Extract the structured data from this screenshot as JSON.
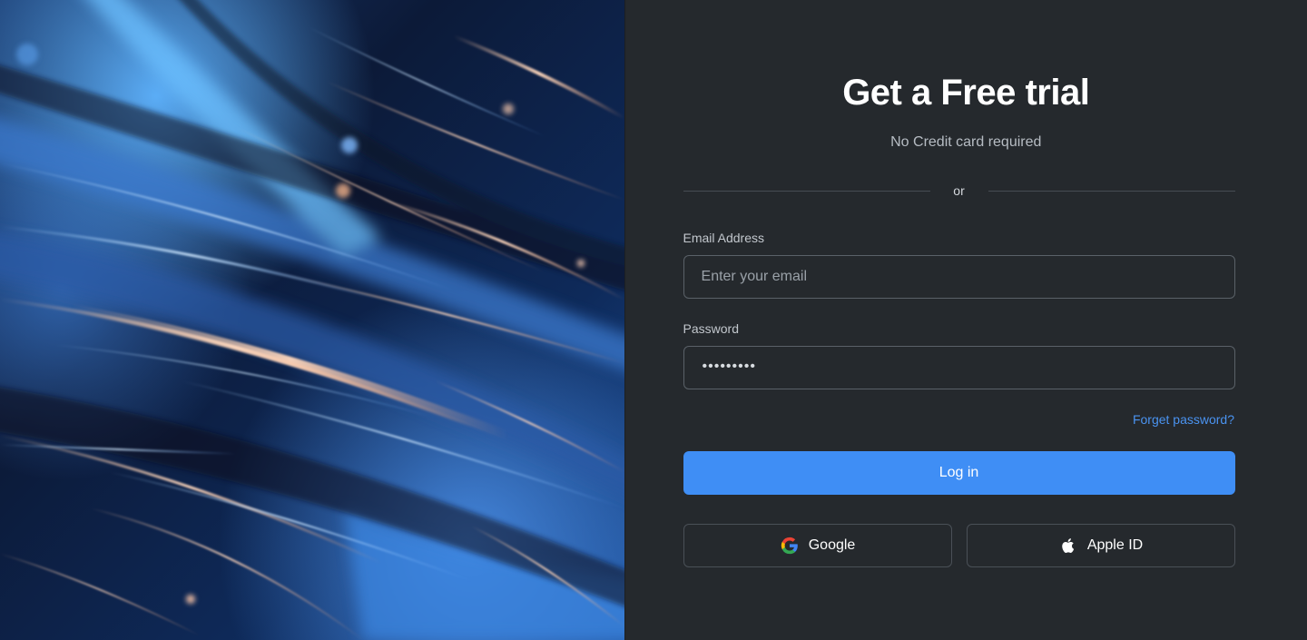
{
  "hero": {
    "image": "abstract-light-streaks"
  },
  "form": {
    "title": "Get a Free trial",
    "subtitle": "No Credit card required",
    "divider_text": "or",
    "email": {
      "label": "Email Address",
      "placeholder": "Enter your email",
      "value": ""
    },
    "password": {
      "label": "Password",
      "masked_value": "•••••••••"
    },
    "forgot_link": "Forget password?",
    "login_button": "Log in",
    "social": {
      "google_label": "Google",
      "google_icon": "google-icon",
      "apple_label": "Apple ID",
      "apple_icon": "apple-icon"
    }
  },
  "colors": {
    "panel_bg": "#25292d",
    "accent": "#3f8ef5",
    "link": "#4a93f0",
    "text_primary": "#ffffff",
    "text_secondary": "#b6bcc3"
  }
}
